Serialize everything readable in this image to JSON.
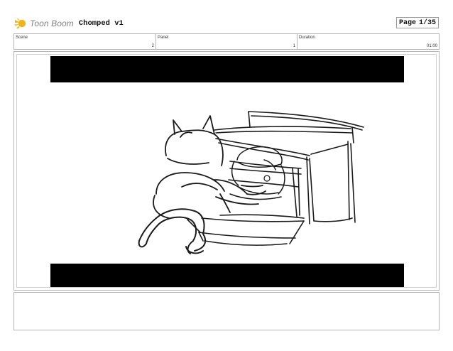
{
  "header": {
    "brand": "Toon Boom",
    "project_title": "Chomped v1",
    "page_label": "Page",
    "page_value": "1/35"
  },
  "info": {
    "scene_label": "Scene",
    "scene_value": "2",
    "panel_label": "Panel",
    "panel_value": "1",
    "duration_label": "Duration",
    "duration_value": "01:00"
  },
  "colors": {
    "brand_sun": "#f2b21c",
    "brand_text": "#808080",
    "letterbox": "#000000",
    "border": "#b5b5b5"
  },
  "icons": [
    "toon-boom-sun-logo-icon"
  ]
}
